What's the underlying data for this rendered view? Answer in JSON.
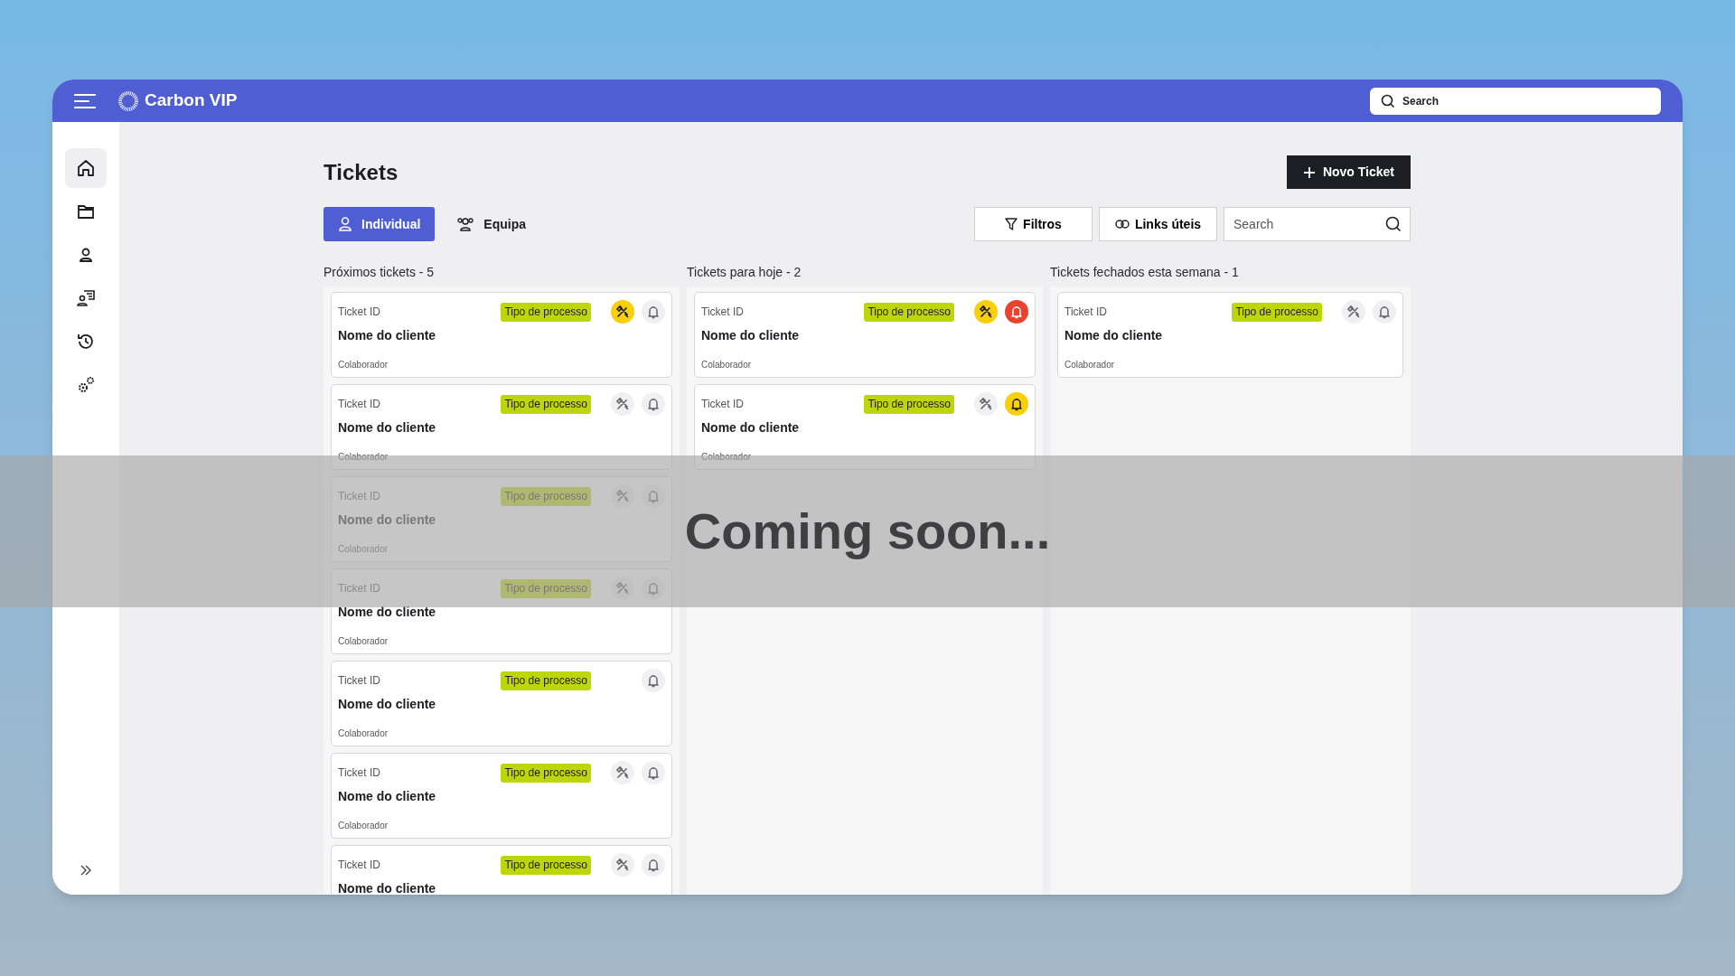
{
  "app": {
    "brand": "Carbon VIP",
    "search": {
      "placeholder": "Search"
    }
  },
  "sidebar": {
    "items": [
      {
        "kind": "home",
        "selected": true
      },
      {
        "kind": "folder",
        "selected": false
      },
      {
        "kind": "user",
        "selected": false
      },
      {
        "kind": "contact",
        "selected": false
      },
      {
        "kind": "history",
        "selected": false
      },
      {
        "kind": "gears",
        "selected": false
      }
    ]
  },
  "page": {
    "title": "Tickets",
    "new_button": "Novo Ticket",
    "views": [
      {
        "label": "Individual",
        "kind": "user",
        "selected": true
      },
      {
        "label": "Equipa",
        "kind": "team",
        "selected": false
      }
    ],
    "filters_button": "Filtros",
    "links_button": "Links úteis",
    "search": {
      "placeholder": "Search"
    }
  },
  "columns": [
    {
      "title": "Próximos tickets - 5",
      "cards": [
        {
          "ticket_id": "Ticket ID",
          "tag": "Tipo de processo",
          "client": "Nome do cliente",
          "collaborator": "Colaborador",
          "tools_active": true,
          "alert_active": false
        },
        {
          "ticket_id": "Ticket ID",
          "tag": "Tipo de processo",
          "client": "Nome do cliente",
          "collaborator": "Colaborador",
          "tools_active": false,
          "alert_active": false
        },
        {
          "ticket_id": "Ticket ID",
          "tag": "Tipo de processo",
          "client": "Nome do cliente",
          "collaborator": "Colaborador",
          "tools_active": false,
          "alert_active": false
        },
        {
          "ticket_id": "Ticket ID",
          "tag": "Tipo de processo",
          "client": "Nome do cliente",
          "collaborator": "Colaborador",
          "tools_active": false,
          "alert_active": false
        },
        {
          "ticket_id": "Ticket ID",
          "tag": "Tipo de processo",
          "client": "Nome do cliente",
          "collaborator": "Colaborador",
          "alert_active": false
        },
        {
          "ticket_id": "Ticket ID",
          "tag": "Tipo de processo",
          "client": "Nome do cliente",
          "collaborator": "Colaborador",
          "tools_active": false,
          "alert_active": false
        },
        {
          "ticket_id": "Ticket ID",
          "tag": "Tipo de processo",
          "client": "Nome do cliente",
          "tools_active": false,
          "alert_active": false
        }
      ]
    },
    {
      "title": "Tickets para hoje - 2",
      "cards": [
        {
          "ticket_id": "Ticket ID",
          "tag": "Tipo de processo",
          "client": "Nome do cliente",
          "collaborator": "Colaborador",
          "tools_active": true,
          "alert_active": true,
          "alert_urgent": true
        },
        {
          "ticket_id": "Ticket ID",
          "tag": "Tipo de processo",
          "client": "Nome do cliente",
          "collaborator": "Colaborador",
          "tools_active": false,
          "alert_active": true,
          "alert_urgent": false
        }
      ]
    },
    {
      "title": "Tickets fechados esta semana - 1",
      "cards": [
        {
          "ticket_id": "Ticket ID",
          "tag": "Tipo de processo",
          "client": "Nome do cliente",
          "collaborator": "Colaborador",
          "tools_active": false,
          "alert_active": false
        }
      ]
    }
  ],
  "overlay": {
    "text": "Coming soon..."
  }
}
